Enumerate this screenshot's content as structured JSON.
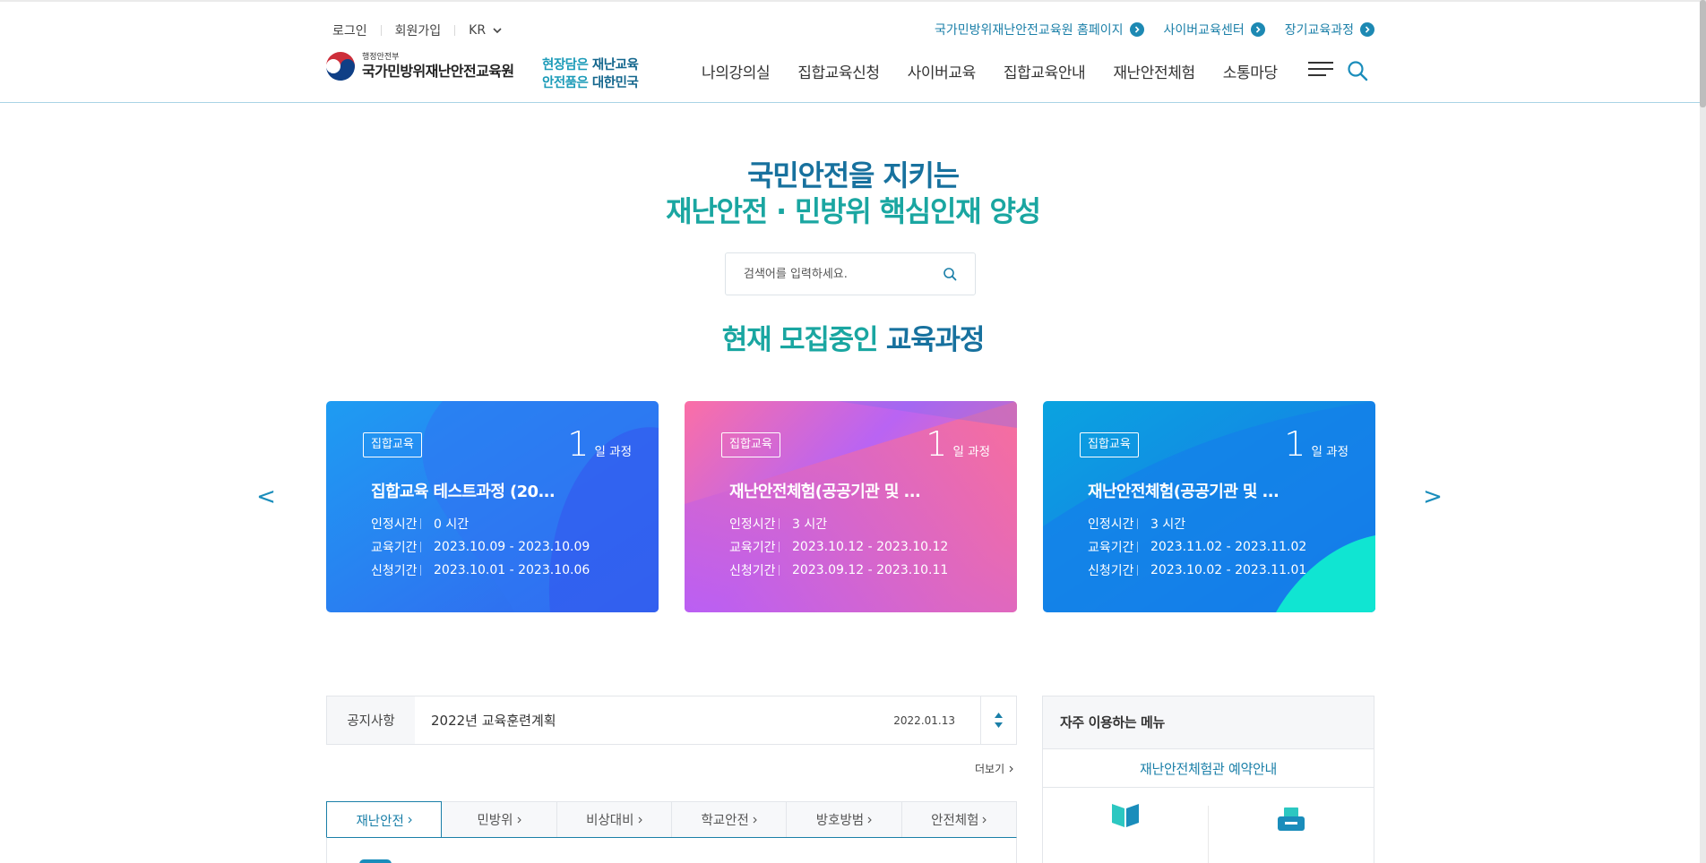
{
  "header": {
    "util_left": {
      "login": "로그인",
      "signup": "회원가입",
      "lang": "KR"
    },
    "util_right": [
      {
        "label": "국가민방위재난안전교육원 홈페이지"
      },
      {
        "label": "사이버교육센터"
      },
      {
        "label": "장기교육과정"
      }
    ],
    "logo": {
      "ministry": "행정안전부",
      "name": "국가민방위재난안전교육원"
    },
    "slogan": {
      "line1_a": "현장담은 ",
      "line1_b": "재난교육",
      "line2_a": "안전품은 ",
      "line2_b": "대한민국"
    },
    "nav": [
      "나의강의실",
      "집합교육신청",
      "사이버교육",
      "집합교육안내",
      "재난안전체험",
      "소통마당"
    ],
    "icons": {
      "menu": "hamburger-menu-icon",
      "search": "search-icon"
    }
  },
  "hero": {
    "title_line1": "국민안전을 지키는",
    "title_line2": "재난안전 · 민방위 핵심인재 양성",
    "search_placeholder": "검색어를 입력하세요.",
    "recruit_a": "현재 모집중인 ",
    "recruit_b": "교육과정"
  },
  "colors": {
    "primary": "#17719e",
    "teal": "#1aa6a1",
    "link": "#1a7fa8"
  },
  "carousel": {
    "prev": "<",
    "next": ">",
    "cards": [
      {
        "badge": "집합교육",
        "days": "1",
        "unit": "일 과정",
        "title": "집합교육 테스트과정 (20...",
        "rows": [
          {
            "k": "인정시간",
            "v": "0 시간"
          },
          {
            "k": "교육기간",
            "v": "2023.10.09 - 2023.10.09"
          },
          {
            "k": "신청기간",
            "v": "2023.10.01 - 2023.10.06"
          }
        ]
      },
      {
        "badge": "집합교육",
        "days": "1",
        "unit": "일 과정",
        "title": "재난안전체험(공공기관 및 ...",
        "rows": [
          {
            "k": "인정시간",
            "v": "3 시간"
          },
          {
            "k": "교육기간",
            "v": "2023.10.12 - 2023.10.12"
          },
          {
            "k": "신청기간",
            "v": "2023.09.12 - 2023.10.11"
          }
        ]
      },
      {
        "badge": "집합교육",
        "days": "1",
        "unit": "일 과정",
        "title": "재난안전체험(공공기관 및 ...",
        "rows": [
          {
            "k": "인정시간",
            "v": "3 시간"
          },
          {
            "k": "교육기간",
            "v": "2023.11.02 - 2023.11.02"
          },
          {
            "k": "신청기간",
            "v": "2023.10.02 - 2023.11.01"
          }
        ]
      }
    ]
  },
  "notice": {
    "label": "공지사항",
    "title": "2022년 교육훈련계획",
    "date": "2022.01.13",
    "more": "더보기"
  },
  "tabs": [
    "재난안전",
    "민방위",
    "비상대비",
    "학교안전",
    "방호방범",
    "안전체험"
  ],
  "quick_menu": {
    "title": "자주 이용하는 메뉴",
    "subtitle": "재난안전체험관 예약안내",
    "icons": [
      "book-icon",
      "printer-icon"
    ]
  }
}
